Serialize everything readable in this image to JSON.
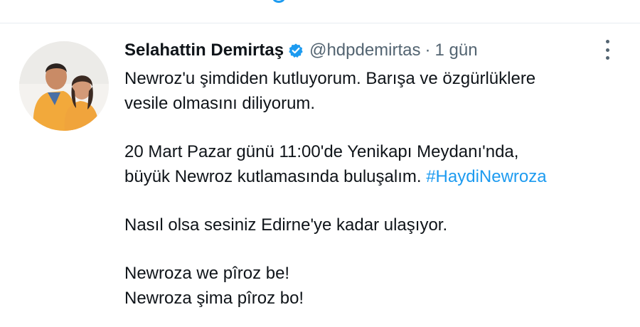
{
  "tweet": {
    "display_name": "Selahattin Demirtaş",
    "handle": "@hdpdemirtas",
    "separator": "·",
    "time": "1 gün",
    "text": {
      "p1_l1": "Newroz'u şimdiden kutluyorum. Barışa ve özgürlüklere",
      "p1_l2": "vesile olmasını diliyorum.",
      "p2_l1": "20 Mart Pazar günü 11:00'de Yenikapı Meydanı'nda,",
      "p2_l2_text": "büyük Newroz kutlamasında buluşalım. ",
      "p2_l2_hashtag": "#HaydiNewroza",
      "p3_l1": "Nasıl olsa sesiniz Edirne'ye kadar ulaşıyor.",
      "p4_l1": "Newroza we pîroz be!",
      "p4_l2": "Newroza şima pîroz bo!"
    }
  },
  "icons": {
    "verified": "verified-badge-icon",
    "more": "more-vertical-icon",
    "avatar": "profile-photo"
  },
  "colors": {
    "accent": "#1d9bf0",
    "text": "#0f1419",
    "muted": "#536471",
    "divider": "#e6ecf0"
  }
}
